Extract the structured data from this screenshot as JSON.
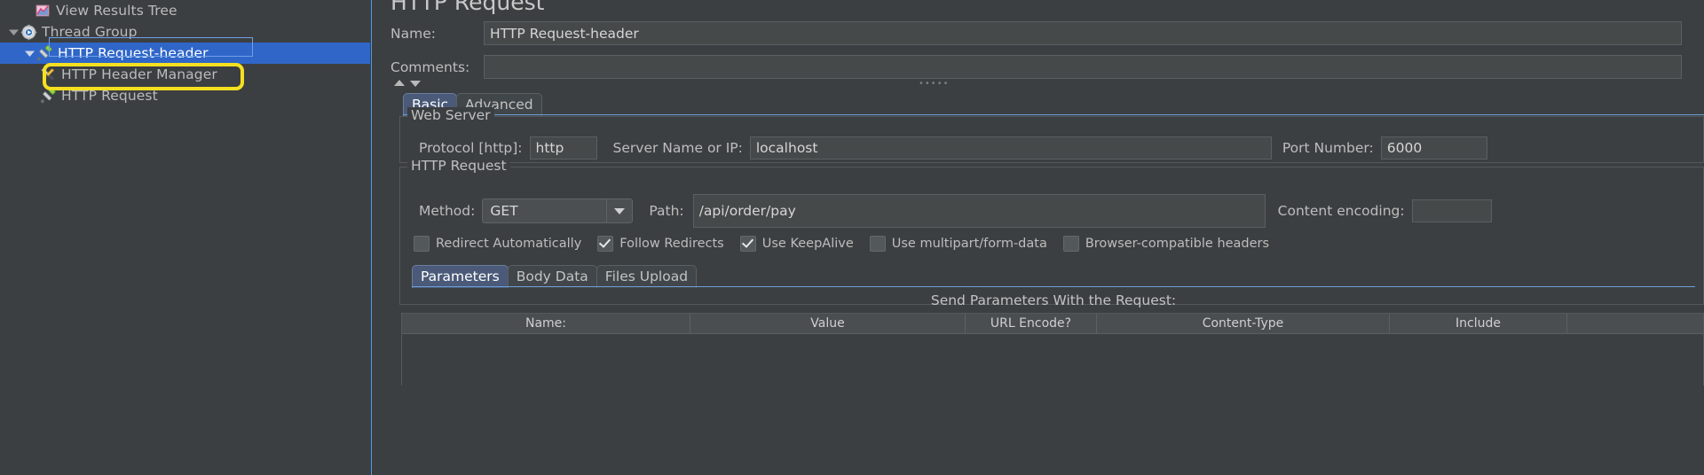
{
  "tree": {
    "items": [
      {
        "label": "View Results Tree",
        "icon": "results-tree-icon",
        "indent": 2,
        "twisty": "none",
        "selected": false
      },
      {
        "label": "Thread Group",
        "icon": "thread-group-icon",
        "indent": 1,
        "twisty": "expanded",
        "selected": false
      },
      {
        "label": "HTTP Request-header",
        "icon": "http-request-icon",
        "indent": 2,
        "twisty": "expanded",
        "selected": true
      },
      {
        "label": "HTTP Header Manager",
        "icon": "header-manager-icon",
        "indent": 3,
        "twisty": "none",
        "selected": false
      },
      {
        "label": "HTTP Request",
        "icon": "http-request-icon",
        "indent": 3,
        "twisty": "none",
        "selected": false
      }
    ],
    "annotation_color": "#f5e020"
  },
  "panel": {
    "title": "HTTP Request",
    "name_label": "Name:",
    "name_value": "HTTP Request-header",
    "comments_label": "Comments:",
    "comments_value": "",
    "tabs": [
      {
        "label": "Basic",
        "active": true
      },
      {
        "label": "Advanced",
        "active": false
      }
    ],
    "web_server": {
      "group_title": "Web Server",
      "protocol_label": "Protocol [http]:",
      "protocol_value": "http",
      "server_label": "Server Name or IP:",
      "server_value": "localhost",
      "port_label": "Port Number:",
      "port_value": "6000"
    },
    "http_request": {
      "group_title": "HTTP Request",
      "method_label": "Method:",
      "method_value": "GET",
      "path_label": "Path:",
      "path_value": "/api/order/pay",
      "content_encoding_label": "Content encoding:",
      "content_encoding_value": "",
      "checkboxes": [
        {
          "label": "Redirect Automatically",
          "checked": false
        },
        {
          "label": "Follow Redirects",
          "checked": true
        },
        {
          "label": "Use KeepAlive",
          "checked": true
        },
        {
          "label": "Use multipart/form-data",
          "checked": false
        },
        {
          "label": "Browser-compatible headers",
          "checked": false
        }
      ],
      "sub_tabs": [
        {
          "label": "Parameters",
          "active": true
        },
        {
          "label": "Body Data",
          "active": false
        },
        {
          "label": "Files Upload",
          "active": false
        }
      ],
      "params_caption": "Send Parameters With the Request:",
      "params_columns": [
        "Name:",
        "Value",
        "URL Encode?",
        "Content-Type",
        "Include"
      ],
      "params_rows": []
    }
  },
  "colors": {
    "background": "#3c3f41",
    "selection": "#2f66c8",
    "accent": "#4a9be8",
    "highlight": "#f5e020",
    "tab_active": "#4a5a78"
  }
}
